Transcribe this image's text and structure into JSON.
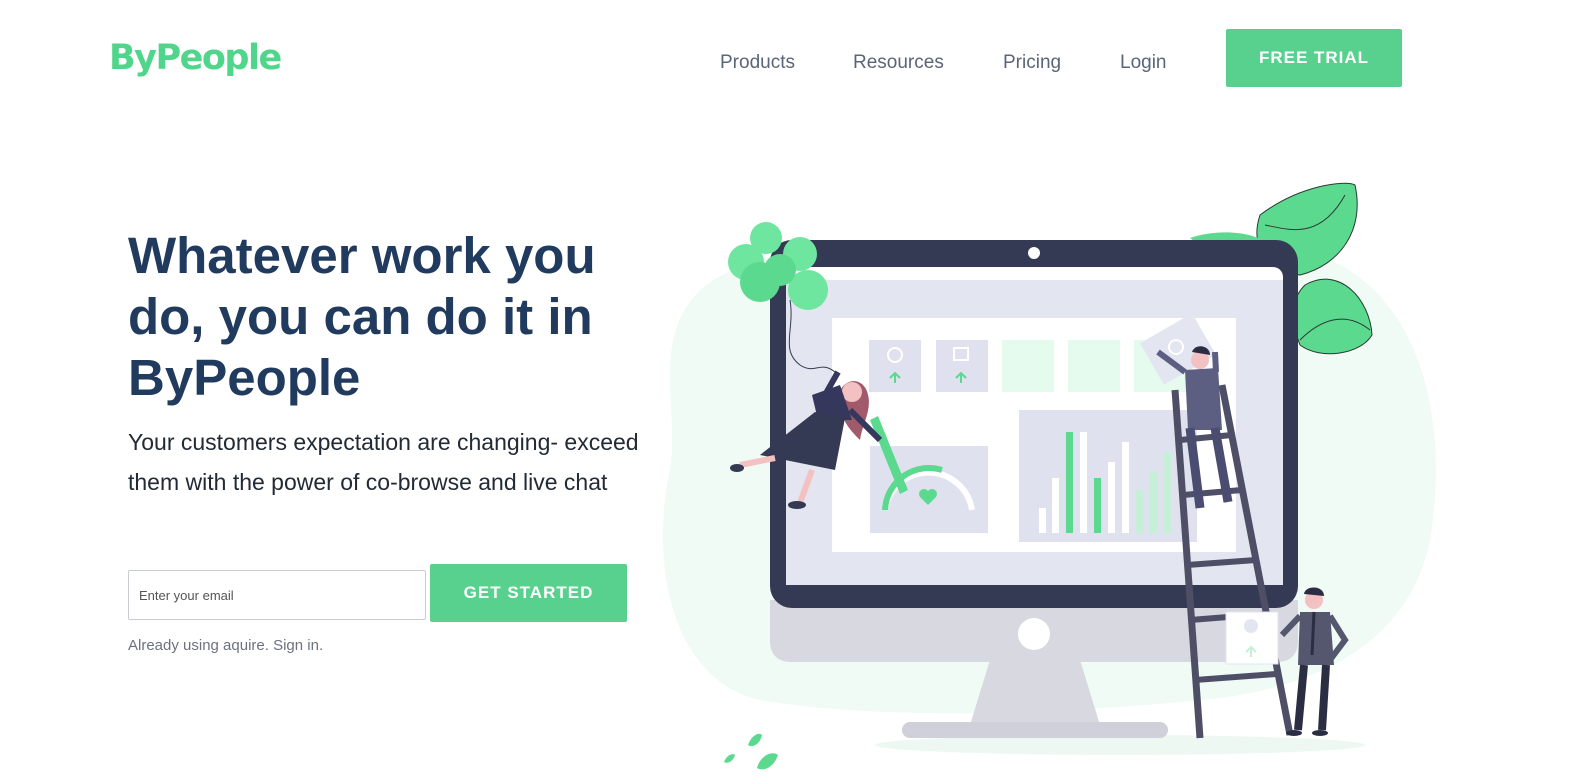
{
  "brand": {
    "logo": "ByPeople",
    "accent": "#58d18e",
    "heading_color": "#213b5e"
  },
  "nav": {
    "items": [
      {
        "label": "Products"
      },
      {
        "label": "Resources"
      },
      {
        "label": "Pricing"
      },
      {
        "label": "Login"
      }
    ],
    "cta": "FREE TRIAL"
  },
  "hero": {
    "headline": "Whatever work you do, you can do it in ByPeople",
    "subtext": "Your customers expectation are changing- exceed them with the power of co-browse and live chat",
    "email_placeholder": "Enter your email",
    "cta": "GET STARTED",
    "signin_prefix": "Already using aquire.",
    "signin_link": "Sign in."
  }
}
